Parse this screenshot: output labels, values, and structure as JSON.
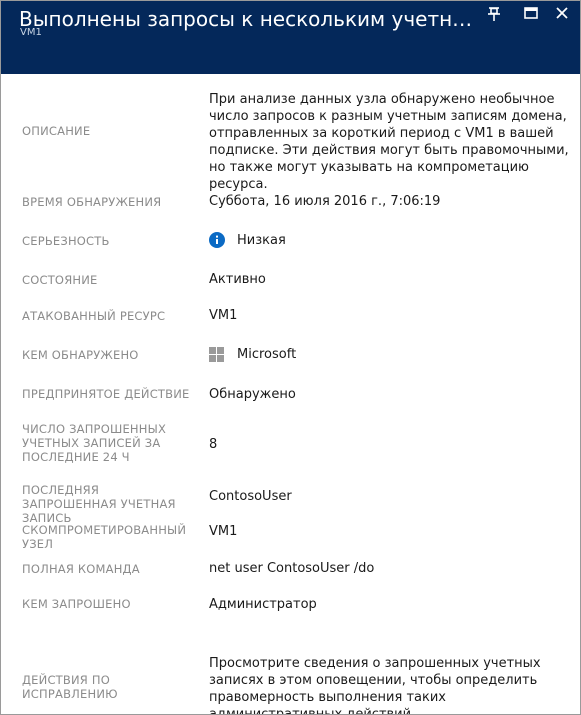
{
  "header": {
    "title": "Выполнены запросы к нескольким учетным записям д...",
    "subtitle": "VM1",
    "background": "#04285a"
  },
  "icons": {
    "pin": "pin-icon",
    "maximize": "maximize-icon",
    "close": "close-icon",
    "severity": "info-icon",
    "detected_by": "windows-logo-icon"
  },
  "fields": {
    "description": {
      "label": "ОПИСАНИЕ",
      "value": "При анализе данных узла обнаружено необычное число запросов к разным учетным записям домена, отправленных за короткий период с VM1 в вашей подписке. Эти действия могут быть правомочными, но также могут указывать на компрометацию ресурса."
    },
    "detection_time": {
      "label": "ВРЕМЯ ОБНАРУЖЕНИЯ",
      "value": "Суббота, 16 июля 2016 г., 7:06:19"
    },
    "severity": {
      "label": "СЕРЬЕЗНОСТЬ",
      "value": "Низкая",
      "color": "#0b6ac4"
    },
    "state": {
      "label": "СОСТОЯНИЕ",
      "value": "Активно"
    },
    "attacked_resource": {
      "label": "АТАКОВАННЫЙ РЕСУРС",
      "value": "VM1"
    },
    "detected_by": {
      "label": "КЕМ ОБНАРУЖЕНО",
      "value": "Microsoft",
      "color": "#9a9a9a"
    },
    "action_taken": {
      "label": "ПРЕДПРИНЯТОЕ ДЕЙСТВИЕ",
      "value": "Обнаружено"
    },
    "queried_accounts_count": {
      "label": "ЧИСЛО ЗАПРОШЕННЫХ УЧЕТНЫХ ЗАПИСЕЙ ЗА ПОСЛЕДНИЕ 24 Ч",
      "value": "8"
    },
    "last_queried_account": {
      "label": "ПОСЛЕДНЯЯ ЗАПРОШЕННАЯ УЧЕТНАЯ ЗАПИСЬ",
      "value": "ContosoUser"
    },
    "compromised_host": {
      "label": "СКОМПРОМЕТИРОВАННЫЙ УЗЕЛ",
      "value": "VM1"
    },
    "full_command": {
      "label": "ПОЛНАЯ КОМАНДА",
      "value": "net user ContosoUser /do"
    },
    "requested_by": {
      "label": "КЕМ ЗАПРОШЕНО",
      "value": "Администратор"
    },
    "remediation": {
      "label": "ДЕЙСТВИЯ ПО ИСПРАВЛЕНИЮ",
      "value": "Просмотрите сведения о запрошенных учетных записях в этом оповещении, чтобы определить правомерность выполнения таких административных действий."
    }
  }
}
